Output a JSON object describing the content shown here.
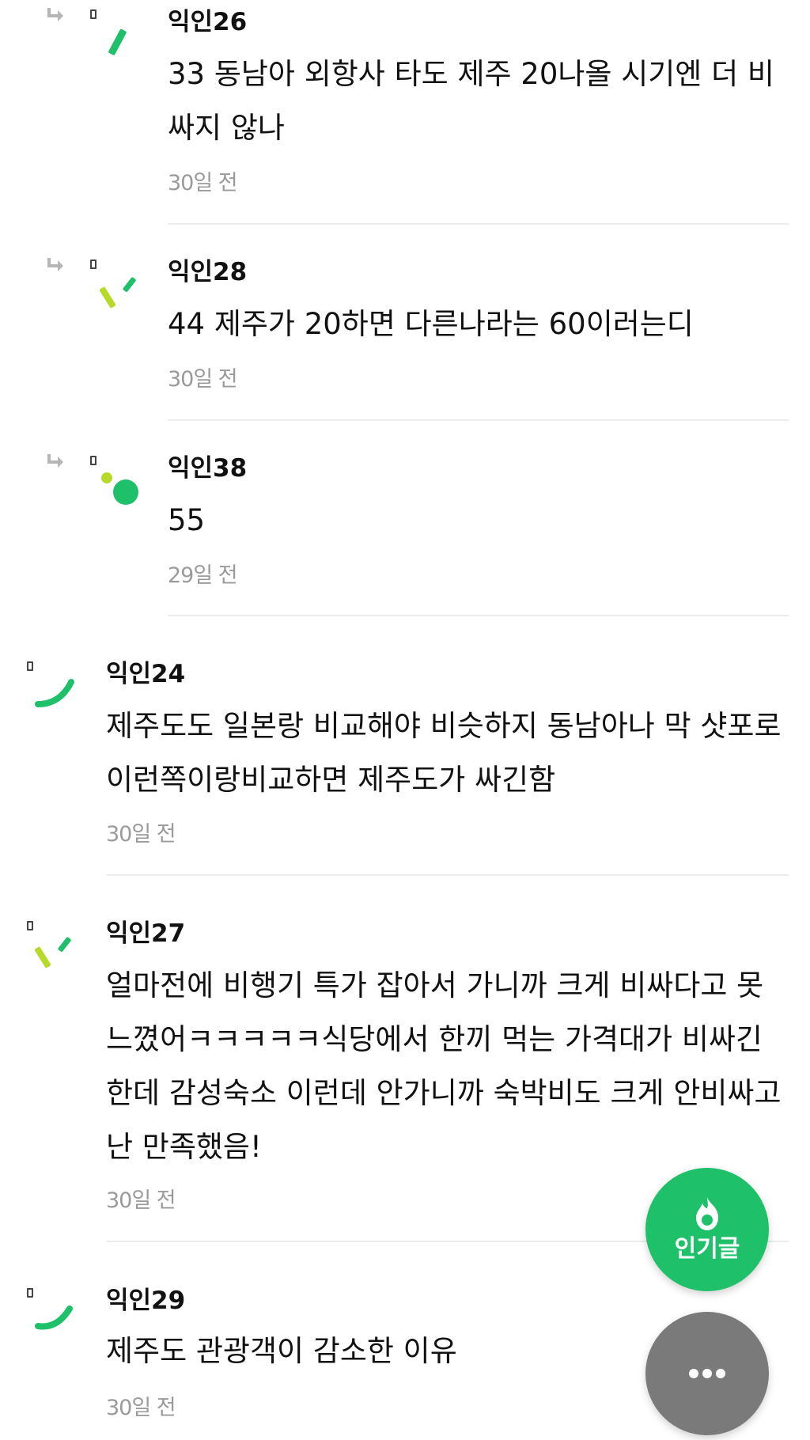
{
  "comments": [
    {
      "author": "익인26",
      "body": "33 동남아 외항사 타도 제주 20나올 시기엔 더 비\n싸지 않나",
      "time": "30일 전",
      "reply": true
    },
    {
      "author": "익인28",
      "body": "44 제주가 20하면 다른나라는 60이러는디",
      "time": "30일 전",
      "reply": true
    },
    {
      "author": "익인38",
      "body": "55",
      "time": "29일 전",
      "reply": true
    },
    {
      "author": "익인24",
      "body": "제주도도 일본랑 비교해야 비슷하지 동남아나 막 샷포로\n이런쪽이랑비교하면 제주도가 싸긴함",
      "time": "30일 전",
      "reply": false
    },
    {
      "author": "익인27",
      "body": "얼마전에 비행기 특가 잡아서 가니까 크게 비싸다고 못\n느꼈어ㅋㅋㅋㅋㅋ식당에서 한끼 먹는 가격대가 비싸긴\n한데 감성숙소 이런데 안가니까 숙박비도 크게 안비싸고\n난 만족했음!",
      "time": "30일 전",
      "reply": false
    },
    {
      "author": "익인29",
      "body": "제주도 관광객이 감소한 이유",
      "time": "30일 전",
      "reply": false
    }
  ],
  "fab": {
    "popular_label": "인기글",
    "popular_icon": "flame-icon",
    "more_icon": "more-dots-icon"
  },
  "colors": {
    "fab_popular": "#1ec16a",
    "fab_more": "#7a7a7a",
    "avatar_green": "#1ec16a",
    "avatar_lime": "#b6d92a"
  }
}
